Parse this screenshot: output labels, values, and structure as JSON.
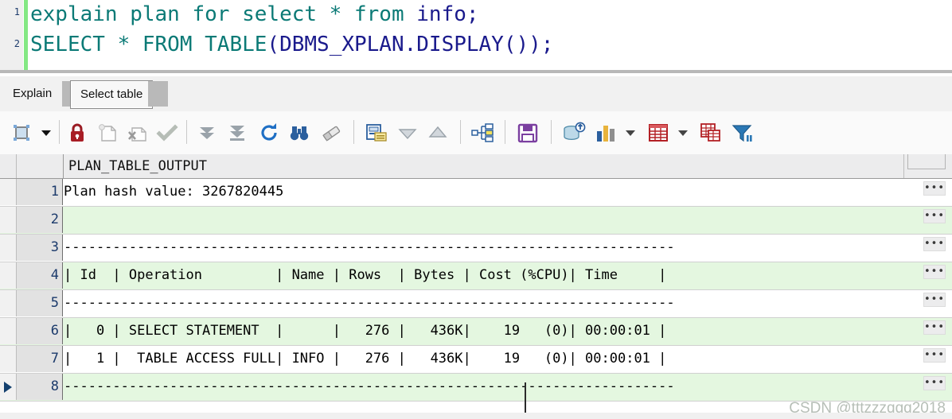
{
  "editor": {
    "line_numbers": [
      "1",
      "2"
    ],
    "lines": [
      {
        "parts": [
          {
            "text": "explain plan for select * from ",
            "kind": "kw"
          },
          {
            "text": "info;",
            "kind": "id"
          }
        ]
      },
      {
        "parts": [
          {
            "text": "SELECT * FROM TABLE",
            "kind": "kw"
          },
          {
            "text": "(DBMS_XPLAN.DISPLAY());",
            "kind": "id"
          }
        ]
      }
    ],
    "line1_kw": "explain plan for select * from ",
    "line1_id": "info;",
    "line2_kw": "SELECT * FROM TABLE",
    "line2_id": "(DBMS_XPLAN.DISPLAY());",
    "change_bar_color": "#84e884",
    "keyword_color": "#0b7a76",
    "identifier_color": "#1a1a8c"
  },
  "tabs": {
    "items": [
      {
        "label": "Explain",
        "active": false
      },
      {
        "label": "Select table",
        "active": true
      }
    ],
    "explain_label": "Explain",
    "select_table_label": "Select table"
  },
  "toolbar": {
    "icons": [
      "select-all-icon",
      "dropdown-caret-icon",
      "lock-icon",
      "copy-record-icon",
      "delete-record-icon",
      "post-changes-icon",
      "next-page-icon",
      "last-page-icon",
      "refresh-icon",
      "find-icon",
      "erase-icon",
      "record-details-icon",
      "sort-descending-icon",
      "sort-ascending-icon",
      "explain-plan-icon",
      "save-icon",
      "export-data-icon",
      "chart-icon",
      "chart-caret-icon",
      "grid-icon",
      "grid-caret-icon",
      "copy-table-icon",
      "filter-icon"
    ]
  },
  "grid": {
    "column_header": "PLAN_TABLE_OUTPUT",
    "row_dots_label": "•••",
    "rows": [
      {
        "num": "1",
        "text": "Plan hash value: 3267820445",
        "selected": false
      },
      {
        "num": "2",
        "text": "",
        "selected": false
      },
      {
        "num": "3",
        "text": "---------------------------------------------------------------------------",
        "selected": false
      },
      {
        "num": "4",
        "text": "| Id  | Operation         | Name | Rows  | Bytes | Cost (%CPU)| Time     |",
        "selected": false
      },
      {
        "num": "5",
        "text": "---------------------------------------------------------------------------",
        "selected": false
      },
      {
        "num": "6",
        "text": "|   0 | SELECT STATEMENT  |      |   276 |   436K|    19   (0)| 00:00:01 |",
        "selected": false
      },
      {
        "num": "7",
        "text": "|   1 |  TABLE ACCESS FULL| INFO |   276 |   436K|    19   (0)| 00:00:01 |",
        "selected": false
      },
      {
        "num": "8",
        "text": "---------------------------------------------------------------------------",
        "selected": true
      }
    ]
  },
  "watermark": {
    "text": "CSDN @tttzzzqqq2018"
  }
}
